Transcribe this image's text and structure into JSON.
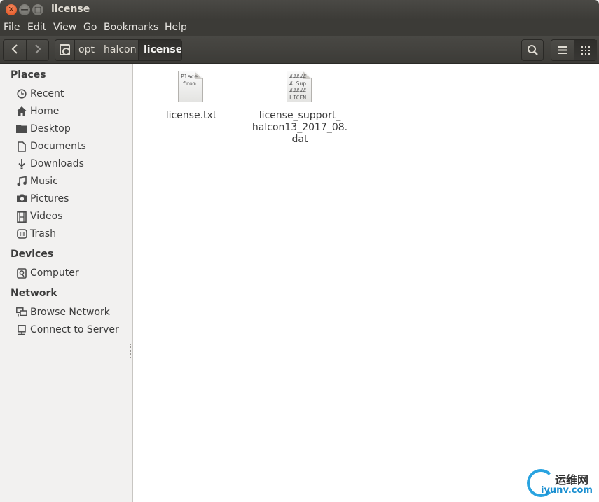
{
  "window": {
    "title": "license"
  },
  "menu": [
    "File",
    "Edit",
    "View",
    "Go",
    "Bookmarks",
    "Help"
  ],
  "breadcrumbs": [
    "opt",
    "halcon",
    "license"
  ],
  "sidebar": {
    "places_label": "Places",
    "places": [
      {
        "label": "Recent",
        "icon": "clock-icon"
      },
      {
        "label": "Home",
        "icon": "home-icon"
      },
      {
        "label": "Desktop",
        "icon": "folder-icon"
      },
      {
        "label": "Documents",
        "icon": "document-icon"
      },
      {
        "label": "Downloads",
        "icon": "download-icon"
      },
      {
        "label": "Music",
        "icon": "music-icon"
      },
      {
        "label": "Pictures",
        "icon": "camera-icon"
      },
      {
        "label": "Videos",
        "icon": "film-icon"
      },
      {
        "label": "Trash",
        "icon": "trash-icon"
      }
    ],
    "devices_label": "Devices",
    "devices": [
      {
        "label": "Computer",
        "icon": "drive-icon"
      }
    ],
    "network_label": "Network",
    "network": [
      {
        "label": "Browse Network",
        "icon": "network-icon"
      },
      {
        "label": "Connect to Server",
        "icon": "server-icon"
      }
    ]
  },
  "files": [
    {
      "name": "license.txt",
      "preview": "Place\nfrom"
    },
    {
      "name": "license_support_\nhalcon13_2017_08.\ndat",
      "preview": "#####\n# Sup\n#####\nLICEN"
    }
  ],
  "watermark": {
    "cn": "运维网",
    "url": "iyunv.com"
  }
}
